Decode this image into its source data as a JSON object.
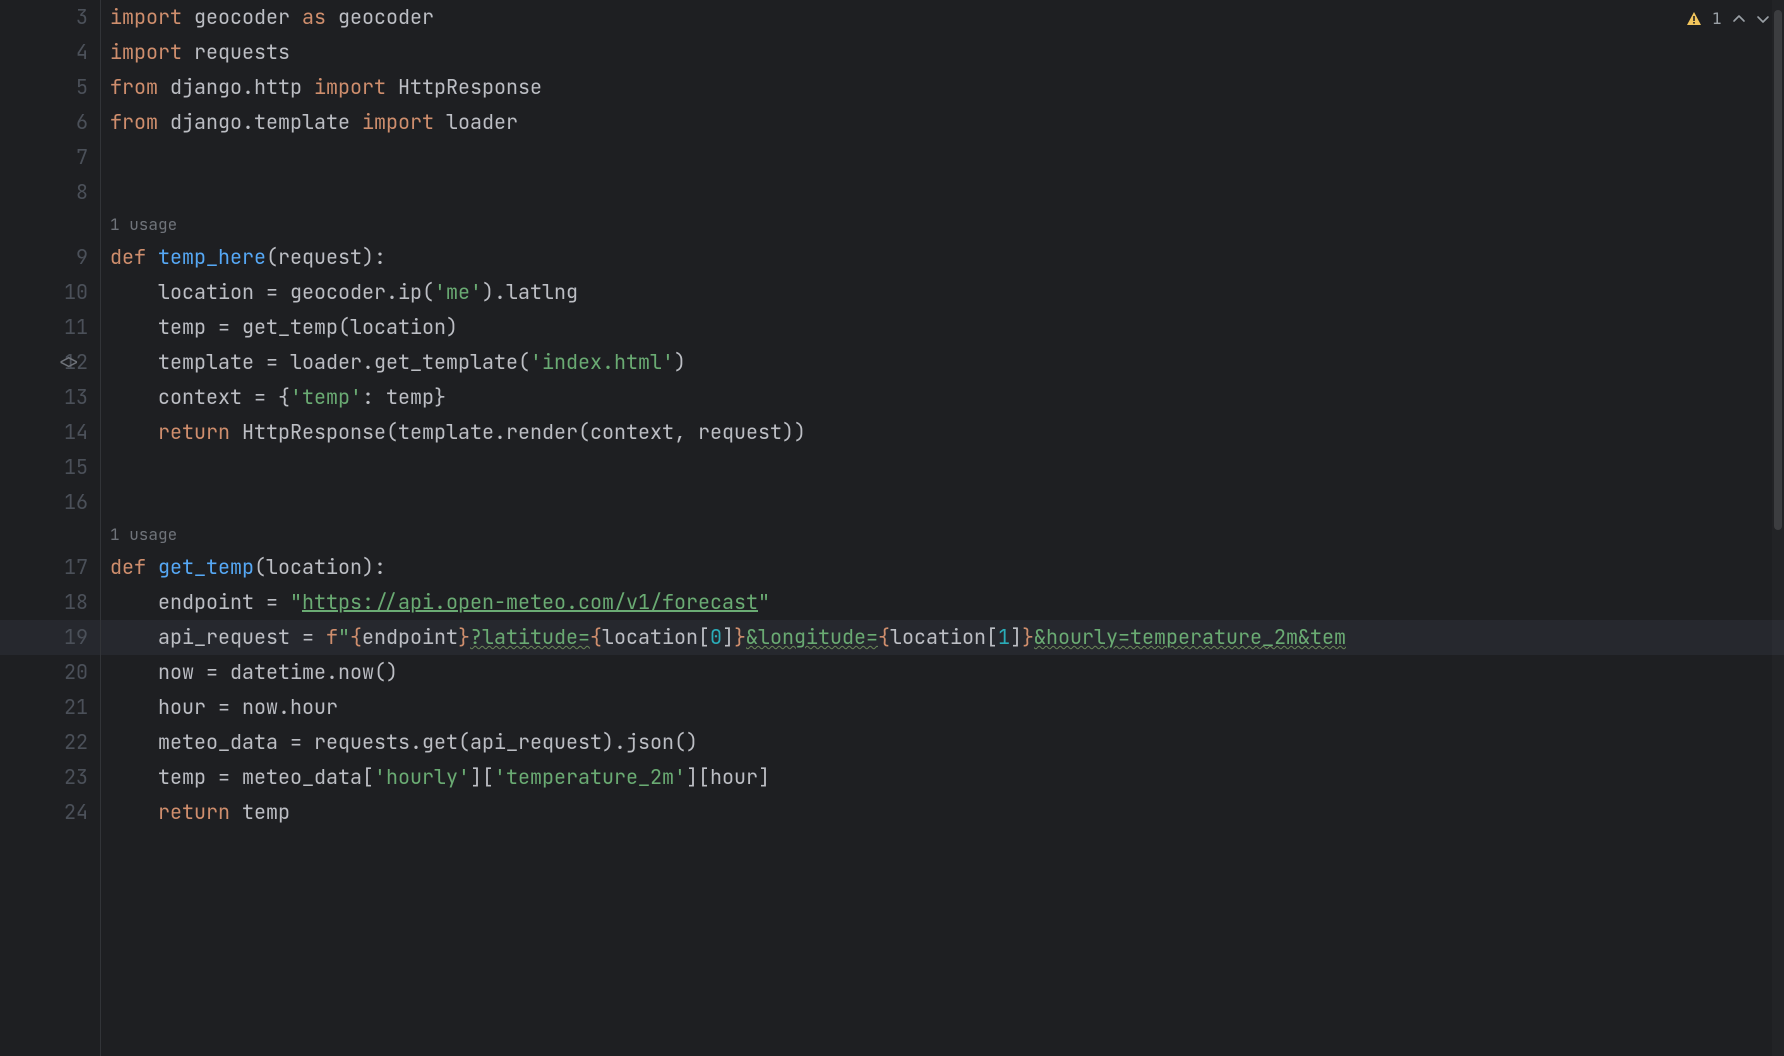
{
  "indicators": {
    "warning_count": "1"
  },
  "gutter": {
    "extra_icon_line": 12
  },
  "inlays": {
    "usage_1": "1 usage",
    "usage_2": "1 usage"
  },
  "lines": [
    {
      "num": "3",
      "tokens": [
        [
          "kw",
          "import "
        ],
        [
          "id",
          "geocoder "
        ],
        [
          "kw",
          "as "
        ],
        [
          "id",
          "geocoder"
        ]
      ]
    },
    {
      "num": "4",
      "tokens": [
        [
          "kw",
          "import "
        ],
        [
          "id",
          "requests"
        ]
      ]
    },
    {
      "num": "5",
      "tokens": [
        [
          "kw",
          "from "
        ],
        [
          "id",
          "django.http "
        ],
        [
          "kw",
          "import "
        ],
        [
          "id",
          "HttpResponse"
        ]
      ]
    },
    {
      "num": "6",
      "tokens": [
        [
          "kw",
          "from "
        ],
        [
          "id",
          "django.template "
        ],
        [
          "kw",
          "import "
        ],
        [
          "id",
          "loader"
        ]
      ]
    },
    {
      "num": "7",
      "tokens": []
    },
    {
      "num": "8",
      "tokens": []
    },
    {
      "num": "",
      "inlay": "usage_1"
    },
    {
      "num": "9",
      "tokens": [
        [
          "kw",
          "def "
        ],
        [
          "def",
          "temp_here"
        ],
        [
          "id",
          "(request):"
        ]
      ]
    },
    {
      "num": "10",
      "tokens": [
        [
          "id",
          "    location = geocoder.ip("
        ],
        [
          "str",
          "'me'"
        ],
        [
          "id",
          ").latlng"
        ]
      ]
    },
    {
      "num": "11",
      "tokens": [
        [
          "id",
          "    temp = get_temp(location)"
        ]
      ]
    },
    {
      "num": "12",
      "tokens": [
        [
          "id",
          "    template = loader.get_template("
        ],
        [
          "str",
          "'index.html'"
        ],
        [
          "id",
          ")"
        ]
      ]
    },
    {
      "num": "13",
      "tokens": [
        [
          "id",
          "    context = {"
        ],
        [
          "str",
          "'temp'"
        ],
        [
          "id",
          ": temp}"
        ]
      ]
    },
    {
      "num": "14",
      "tokens": [
        [
          "id",
          "    "
        ],
        [
          "kw",
          "return "
        ],
        [
          "id",
          "HttpResponse(template.render(context, request))"
        ]
      ]
    },
    {
      "num": "15",
      "tokens": []
    },
    {
      "num": "16",
      "tokens": []
    },
    {
      "num": "",
      "inlay": "usage_2"
    },
    {
      "num": "17",
      "tokens": [
        [
          "kw",
          "def "
        ],
        [
          "def",
          "get_temp"
        ],
        [
          "id",
          "(location):"
        ]
      ]
    },
    {
      "num": "18",
      "tokens": [
        [
          "id",
          "    endpoint = "
        ],
        [
          "str",
          "\""
        ],
        [
          "link",
          "https://api.open-meteo.com/v1/forecast"
        ],
        [
          "str",
          "\""
        ]
      ]
    },
    {
      "num": "19",
      "hl": true,
      "tokens": [
        [
          "id",
          "    api_request = "
        ],
        [
          "kw",
          "f"
        ],
        [
          "str",
          "\""
        ],
        [
          "emb",
          "{"
        ],
        [
          "id",
          "endpoint"
        ],
        [
          "emb",
          "}"
        ],
        [
          "strtypo",
          "?latitude="
        ],
        [
          "emb",
          "{"
        ],
        [
          "id",
          "location["
        ],
        [
          "num",
          "0"
        ],
        [
          "id",
          "]"
        ],
        [
          "emb",
          "}"
        ],
        [
          "strtypo",
          "&longitude="
        ],
        [
          "emb",
          "{"
        ],
        [
          "id",
          "location["
        ],
        [
          "num",
          "1"
        ],
        [
          "id",
          "]"
        ],
        [
          "emb",
          "}"
        ],
        [
          "strtypo",
          "&hourly=temperature_2m&tem"
        ]
      ]
    },
    {
      "num": "20",
      "tokens": [
        [
          "id",
          "    now = datetime.now()"
        ]
      ]
    },
    {
      "num": "21",
      "tokens": [
        [
          "id",
          "    hour = now.hour"
        ]
      ]
    },
    {
      "num": "22",
      "tokens": [
        [
          "id",
          "    meteo_data = requests.get(api_request).json()"
        ]
      ]
    },
    {
      "num": "23",
      "tokens": [
        [
          "id",
          "    temp = meteo_data["
        ],
        [
          "str",
          "'hourly'"
        ],
        [
          "id",
          "]["
        ],
        [
          "str",
          "'temperature_2m'"
        ],
        [
          "id",
          "][hour]"
        ]
      ]
    },
    {
      "num": "24",
      "tokens": [
        [
          "id",
          "    "
        ],
        [
          "kw",
          "return "
        ],
        [
          "id",
          "temp"
        ]
      ]
    }
  ]
}
